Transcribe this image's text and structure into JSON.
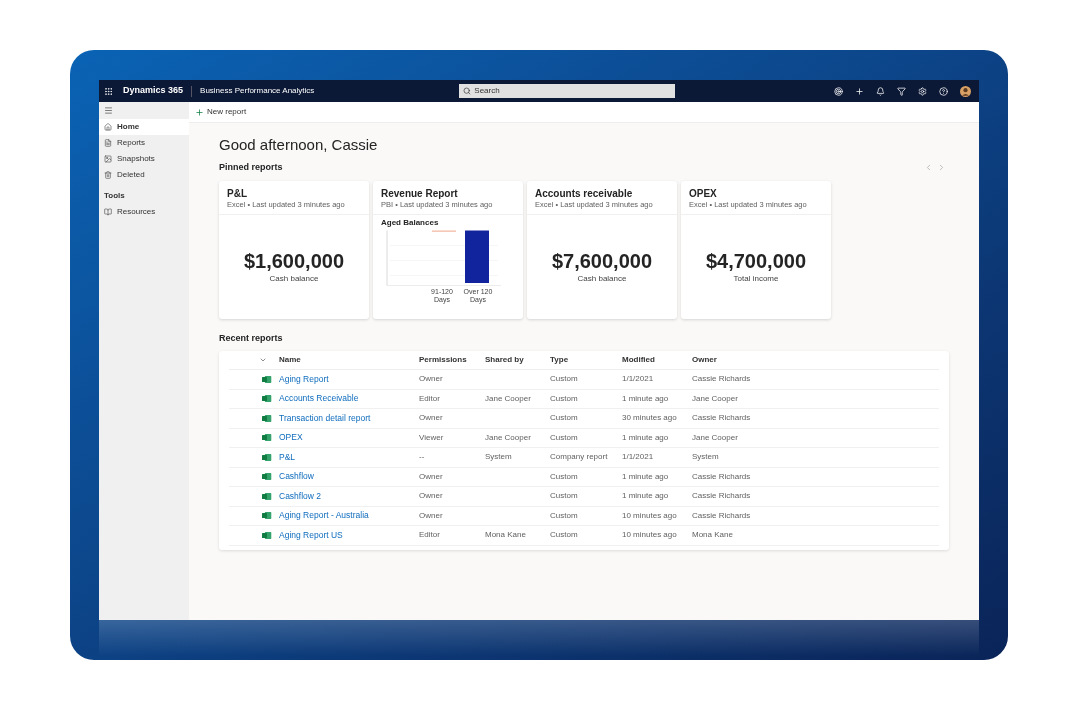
{
  "topbar": {
    "app_name": "Dynamics 365",
    "area_name": "Business Performance Analytics",
    "search": {
      "placeholder": "Search"
    }
  },
  "sidebar": {
    "items": [
      {
        "kind": "home",
        "label": "Home",
        "selected": true
      },
      {
        "kind": "reports",
        "label": "Reports",
        "selected": false
      },
      {
        "kind": "snapshots",
        "label": "Snapshots",
        "selected": false
      },
      {
        "kind": "deleted",
        "label": "Deleted",
        "selected": false
      },
      {
        "kind": "section",
        "label": "Tools"
      },
      {
        "kind": "resources",
        "label": "Resources",
        "selected": false
      }
    ]
  },
  "command_bar": {
    "new_button": "New report"
  },
  "greeting": "Good afternoon, Cassie",
  "pinned": {
    "title": "Pinned reports",
    "cards": [
      {
        "kind": "metric",
        "title": "P&L",
        "subtitle": "Excel • Last updated 3 minutes ago",
        "value": "$1,600,000",
        "caption": "Cash balance"
      },
      {
        "kind": "chart",
        "title": "Revenue Report",
        "subtitle": "PBI • Last updated 3 minutes ago",
        "chart_title": "Aged Balances",
        "categories": [
          "91-120 Days",
          "Over 120 Days"
        ]
      },
      {
        "kind": "metric",
        "title": "Accounts receivable",
        "subtitle": "Excel • Last updated 3 minutes ago",
        "value": "$7,600,000",
        "caption": "Cash balance"
      },
      {
        "kind": "metric",
        "title": "OPEX",
        "subtitle": "Excel • Last updated 3 minutes ago",
        "value": "$4,700,000",
        "caption": "Total income"
      }
    ]
  },
  "recent": {
    "title": "Recent reports",
    "columns": [
      "Name",
      "Permissions",
      "Shared by",
      "Type",
      "Modified",
      "Owner"
    ],
    "rows": [
      [
        "Aging Report",
        "Owner",
        "",
        "Custom",
        "1/1/2021",
        "Cassie Richards"
      ],
      [
        "Accounts Receivable",
        "Editor",
        "Jane Cooper",
        "Custom",
        "1 minute ago",
        "Jane Cooper"
      ],
      [
        "Transaction detail report",
        "Owner",
        "",
        "Custom",
        "30 minutes ago",
        "Cassie Richards"
      ],
      [
        "OPEX",
        "Viewer",
        "Jane Cooper",
        "Custom",
        "1 minute ago",
        "Jane Cooper"
      ],
      [
        "P&L",
        "--",
        "System",
        "Company report",
        "1/1/2021",
        "System"
      ],
      [
        "Cashflow",
        "Owner",
        "",
        "Custom",
        "1 minute ago",
        "Cassie Richards"
      ],
      [
        "Cashflow 2",
        "Owner",
        "",
        "Custom",
        "1 minute ago",
        "Cassie Richards"
      ],
      [
        "Aging Report - Australia",
        "Owner",
        "",
        "Custom",
        "10 minutes ago",
        "Cassie Richards"
      ],
      [
        "Aging Report US",
        "Editor",
        "Mona Kane",
        "Custom",
        "10 minutes ago",
        "Mona Kane"
      ]
    ]
  }
}
